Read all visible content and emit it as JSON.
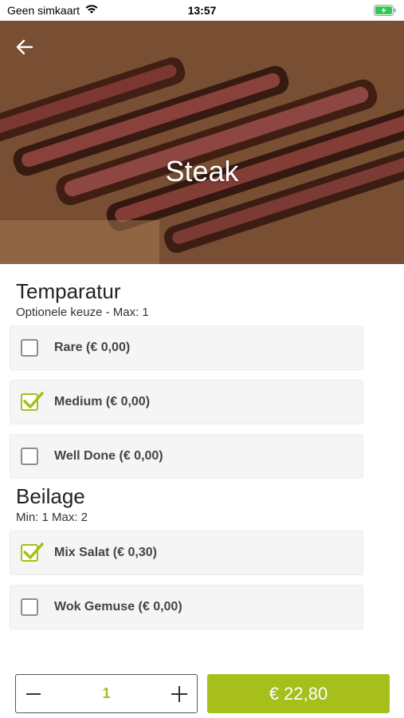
{
  "status_bar": {
    "carrier": "Geen simkaart",
    "time": "13:57",
    "icons": [
      "wifi-icon",
      "battery-charging-icon"
    ],
    "battery_color": "#34c759"
  },
  "header": {
    "title": "Steak",
    "back_icon": "arrow-left-icon"
  },
  "groups": [
    {
      "title": "Temparatur",
      "subtitle": "Optionele keuze - Max: 1",
      "options": [
        {
          "label": "Rare (€ 0,00)",
          "checked": false
        },
        {
          "label": "Medium (€ 0,00)",
          "checked": true
        },
        {
          "label": "Well Done (€ 0,00)",
          "checked": false
        }
      ]
    },
    {
      "title": "Beilage",
      "subtitle": "Min: 1 Max: 2",
      "options": [
        {
          "label": "Mix Salat (€ 0,30)",
          "checked": true
        },
        {
          "label": "Wok Gemuse (€ 0,00)",
          "checked": false
        }
      ]
    }
  ],
  "footer": {
    "quantity": "1",
    "minus_icon": "minus-icon",
    "plus_icon": "plus-icon",
    "total_label": "€ 22,80"
  },
  "colors": {
    "accent": "#a6bf1b",
    "option_background": "#f5f5f5"
  }
}
